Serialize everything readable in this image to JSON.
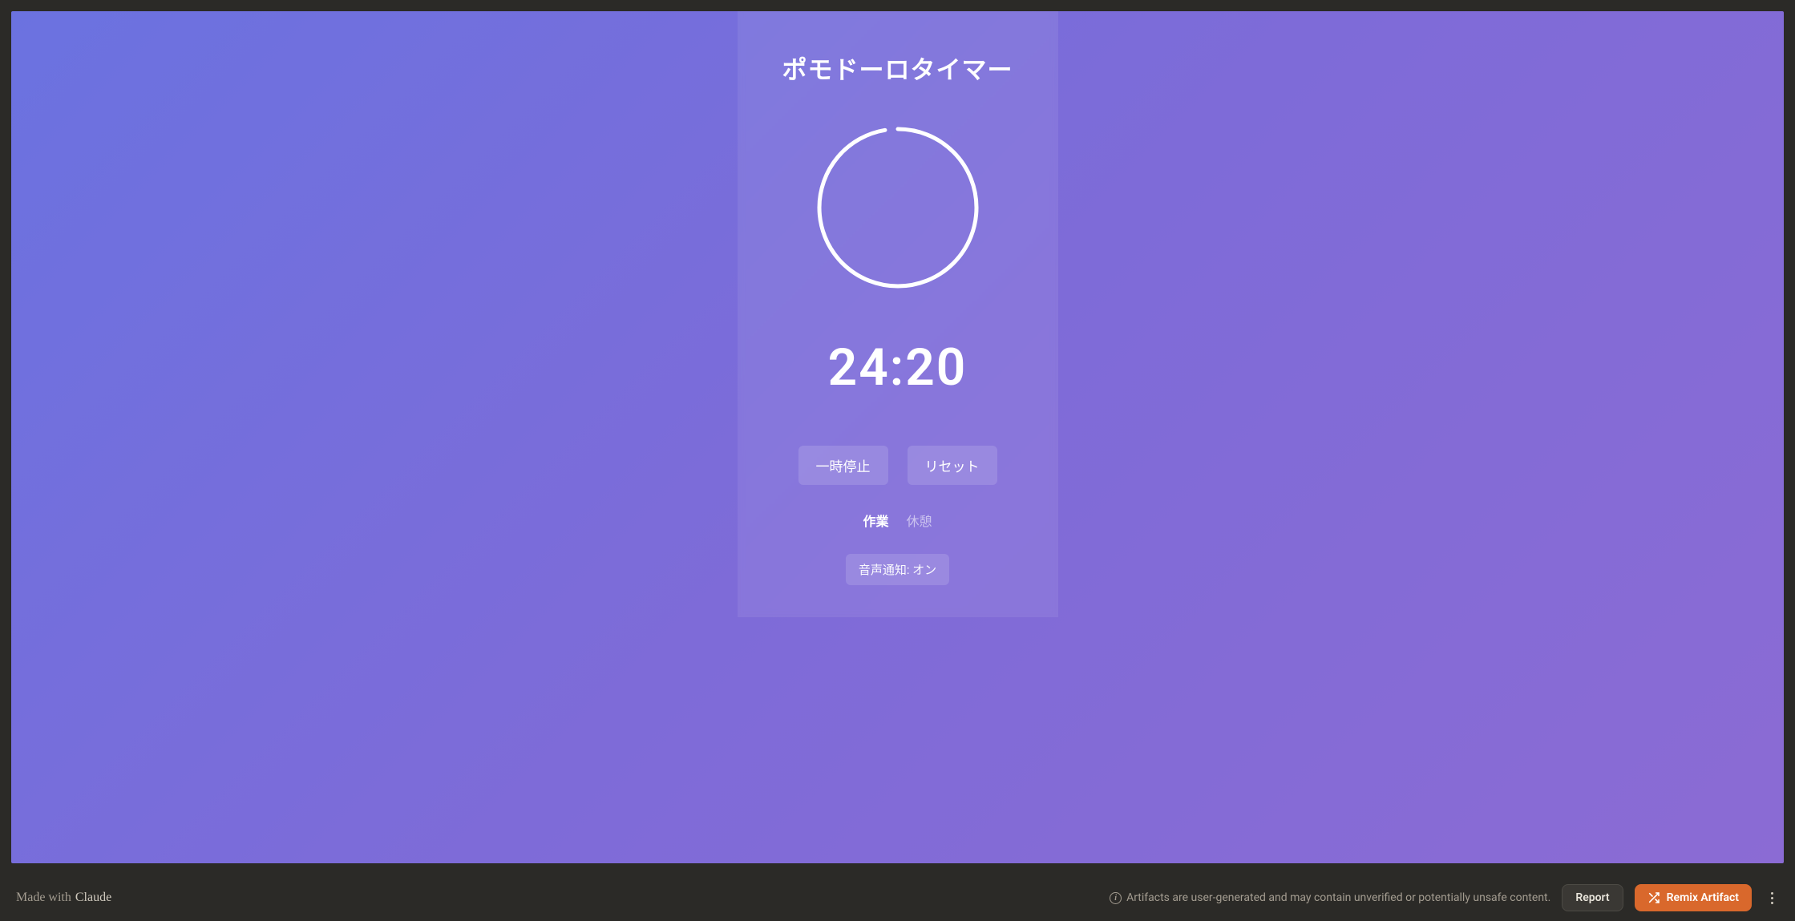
{
  "app": {
    "title": "ポモドーロタイマー",
    "time_display": "24:20",
    "timer": {
      "total_seconds": 1500,
      "remaining_seconds": 1460,
      "progress_fraction": 0.9733
    },
    "buttons": {
      "pause_label": "一時停止",
      "reset_label": "リセット",
      "sound_toggle_label": "音声通知: オン"
    },
    "modes": {
      "work_label": "作業",
      "break_label": "休憩",
      "active": "work"
    },
    "colors": {
      "gradient_start": "#6b72e0",
      "gradient_end": "#8b6bd4",
      "ring_stroke": "#ffffff"
    }
  },
  "footer": {
    "made_with_prefix": "Made with",
    "made_with_brand": "Claude",
    "warning_text": "Artifacts are user-generated and may contain unverified or potentially unsafe content.",
    "report_label": "Report",
    "remix_label": "Remix Artifact"
  }
}
